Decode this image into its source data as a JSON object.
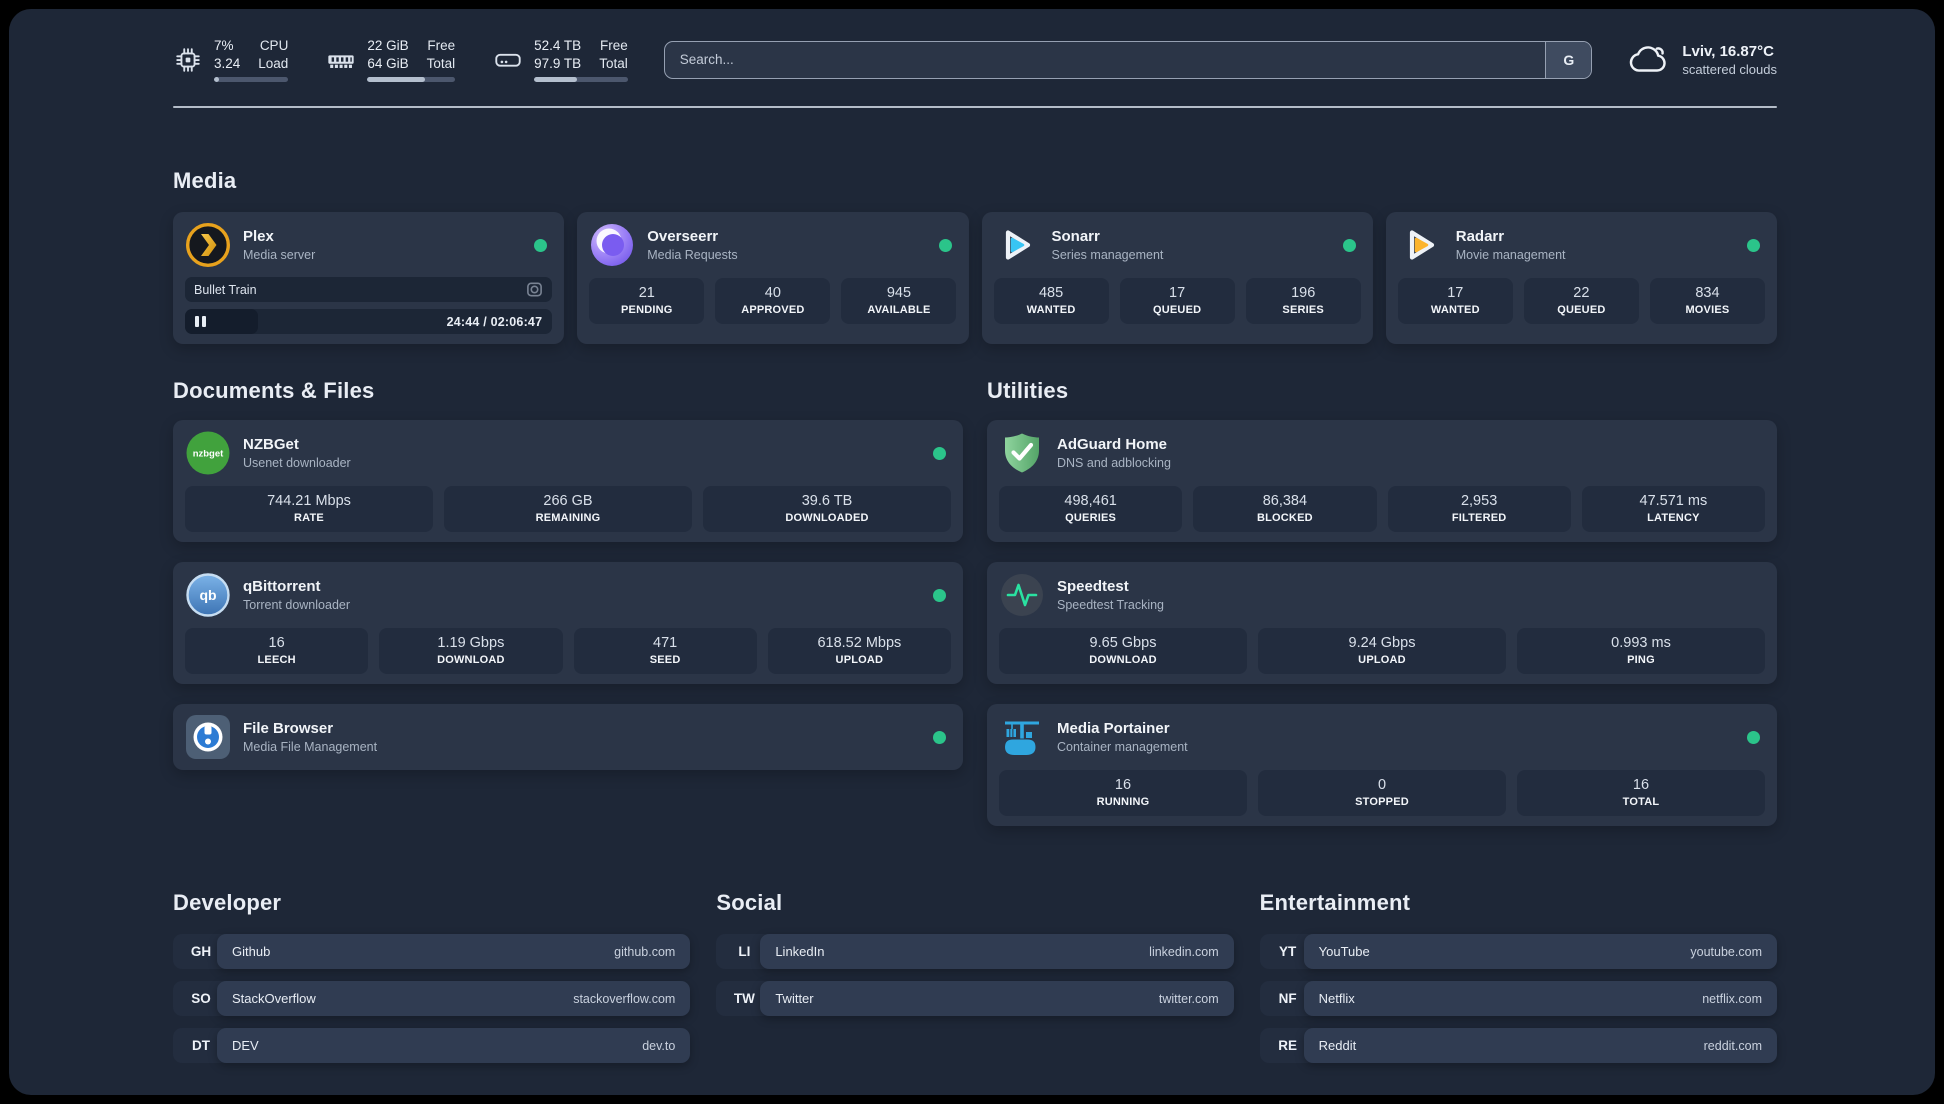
{
  "theme": {
    "status_green": "#2bc48a",
    "plex_amber": "#e8a21d",
    "sonarr_cyan": "#38c5f4",
    "radarr_yellow": "#fcb42c",
    "portainer_blue": "#2fa6df",
    "adguard_green": "#6fbe82",
    "speedtest_pulse": "#2ae2a1"
  },
  "header": {
    "system_stats": [
      {
        "id": "cpu",
        "value_top": "7%",
        "value_bottom": "3.24",
        "label_top": "CPU",
        "label_bottom": "Load",
        "progress_pct": 7
      },
      {
        "id": "memory",
        "value_top": "22 GiB",
        "value_bottom": "64 GiB",
        "label_top": "Free",
        "label_bottom": "Total",
        "progress_pct": 66
      },
      {
        "id": "disk",
        "value_top": "52.4 TB",
        "value_bottom": "97.9 TB",
        "label_top": "Free",
        "label_bottom": "Total",
        "progress_pct": 46
      }
    ],
    "search": {
      "placeholder": "Search...",
      "button_label": "G"
    },
    "weather": {
      "location_temp": "Lviv, 16.87°C",
      "condition": "scattered clouds"
    }
  },
  "media": {
    "title": "Media",
    "plex": {
      "name": "Plex",
      "subtitle": "Media server",
      "now_playing": {
        "title": "Bullet Train",
        "time": "24:44 / 02:06:47",
        "progress_pct": 20
      }
    },
    "overseerr": {
      "name": "Overseerr",
      "subtitle": "Media Requests",
      "stats": [
        {
          "value": "21",
          "label": "PENDING"
        },
        {
          "value": "40",
          "label": "APPROVED"
        },
        {
          "value": "945",
          "label": "AVAILABLE"
        }
      ]
    },
    "sonarr": {
      "name": "Sonarr",
      "subtitle": "Series management",
      "stats": [
        {
          "value": "485",
          "label": "WANTED"
        },
        {
          "value": "17",
          "label": "QUEUED"
        },
        {
          "value": "196",
          "label": "SERIES"
        }
      ]
    },
    "radarr": {
      "name": "Radarr",
      "subtitle": "Movie management",
      "stats": [
        {
          "value": "17",
          "label": "WANTED"
        },
        {
          "value": "22",
          "label": "QUEUED"
        },
        {
          "value": "834",
          "label": "MOVIES"
        }
      ]
    }
  },
  "documents": {
    "title": "Documents & Files",
    "nzbget": {
      "name": "NZBGet",
      "subtitle": "Usenet downloader",
      "icon_text": "nzbget",
      "stats": [
        {
          "value": "744.21 Mbps",
          "label": "RATE"
        },
        {
          "value": "266 GB",
          "label": "REMAINING"
        },
        {
          "value": "39.6 TB",
          "label": "DOWNLOADED"
        }
      ]
    },
    "qbittorrent": {
      "name": "qBittorrent",
      "subtitle": "Torrent downloader",
      "icon_text": "qb",
      "stats": [
        {
          "value": "16",
          "label": "LEECH"
        },
        {
          "value": "1.19 Gbps",
          "label": "DOWNLOAD"
        },
        {
          "value": "471",
          "label": "SEED"
        },
        {
          "value": "618.52 Mbps",
          "label": "UPLOAD"
        }
      ]
    },
    "filebrowser": {
      "name": "File Browser",
      "subtitle": "Media File Management"
    }
  },
  "utilities": {
    "title": "Utilities",
    "adguard": {
      "name": "AdGuard Home",
      "subtitle": "DNS and adblocking",
      "stats": [
        {
          "value": "498,461",
          "label": "QUERIES"
        },
        {
          "value": "86,384",
          "label": "BLOCKED"
        },
        {
          "value": "2,953",
          "label": "FILTERED"
        },
        {
          "value": "47.571 ms",
          "label": "LATENCY"
        }
      ]
    },
    "speedtest": {
      "name": "Speedtest",
      "subtitle": "Speedtest Tracking",
      "stats": [
        {
          "value": "9.65 Gbps",
          "label": "DOWNLOAD"
        },
        {
          "value": "9.24 Gbps",
          "label": "UPLOAD"
        },
        {
          "value": "0.993 ms",
          "label": "PING"
        }
      ]
    },
    "portainer": {
      "name": "Media Portainer",
      "subtitle": "Container management",
      "stats": [
        {
          "value": "16",
          "label": "RUNNING"
        },
        {
          "value": "0",
          "label": "STOPPED"
        },
        {
          "value": "16",
          "label": "TOTAL"
        }
      ]
    }
  },
  "links": {
    "developer": {
      "title": "Developer",
      "items": [
        {
          "abbr": "GH",
          "name": "Github",
          "url": "github.com"
        },
        {
          "abbr": "SO",
          "name": "StackOverflow",
          "url": "stackoverflow.com"
        },
        {
          "abbr": "DT",
          "name": "DEV",
          "url": "dev.to"
        }
      ]
    },
    "social": {
      "title": "Social",
      "items": [
        {
          "abbr": "LI",
          "name": "LinkedIn",
          "url": "linkedin.com"
        },
        {
          "abbr": "TW",
          "name": "Twitter",
          "url": "twitter.com"
        }
      ]
    },
    "entertainment": {
      "title": "Entertainment",
      "items": [
        {
          "abbr": "YT",
          "name": "YouTube",
          "url": "youtube.com"
        },
        {
          "abbr": "NF",
          "name": "Netflix",
          "url": "netflix.com"
        },
        {
          "abbr": "RE",
          "name": "Reddit",
          "url": "reddit.com"
        }
      ]
    }
  }
}
